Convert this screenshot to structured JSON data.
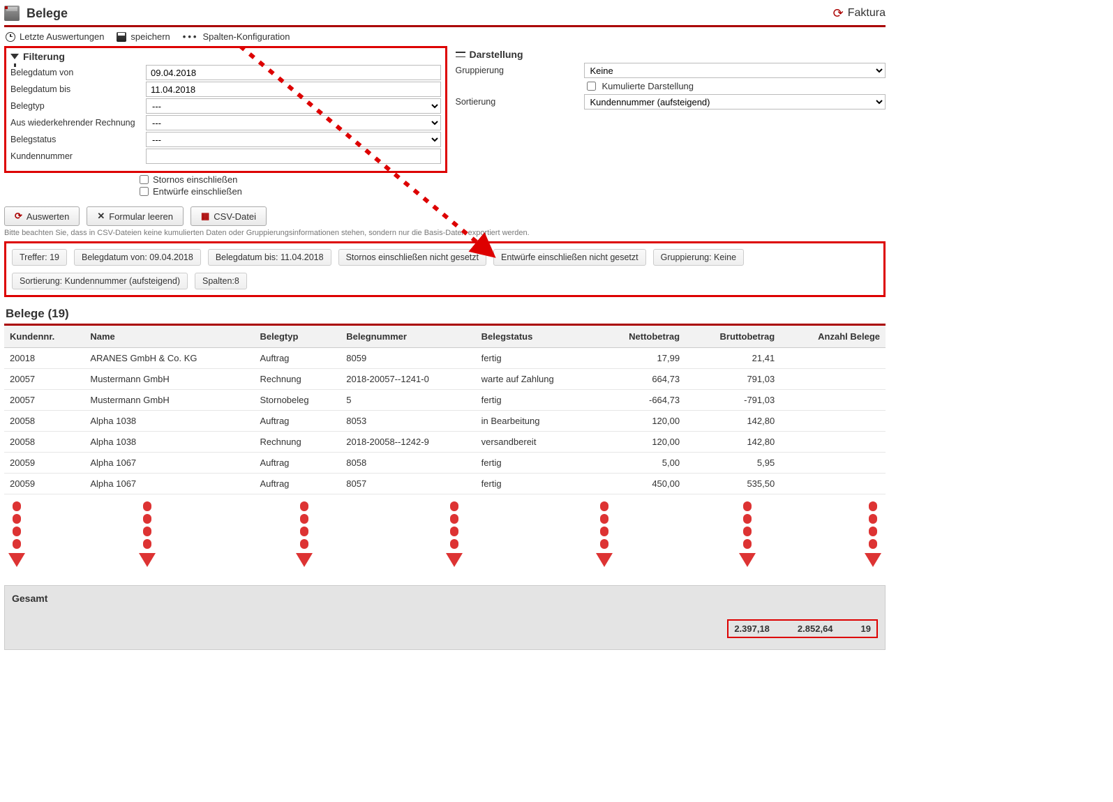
{
  "header": {
    "title": "Belege",
    "app_name": "Faktura"
  },
  "toolbar": {
    "recent": "Letzte Auswertungen",
    "save": "speichern",
    "columns": "Spalten-Konfiguration"
  },
  "filter": {
    "header": "Filterung",
    "labels": {
      "date_from": "Belegdatum von",
      "date_to": "Belegdatum bis",
      "beltype": "Belegtyp",
      "recurring": "Aus wiederkehrender Rechnung",
      "status": "Belegstatus",
      "custno": "Kundennummer"
    },
    "values": {
      "date_from": "09.04.2018",
      "date_to": "11.04.2018",
      "beltype": "---",
      "recurring": "---",
      "status": "---",
      "custno": ""
    },
    "checks": {
      "stornos": "Stornos einschließen",
      "drafts": "Entwürfe einschließen"
    }
  },
  "display": {
    "header": "Darstellung",
    "labels": {
      "grouping": "Gruppierung",
      "cumulated": "Kumulierte Darstellung",
      "sorting": "Sortierung"
    },
    "values": {
      "grouping": "Keine",
      "sorting": "Kundennummer (aufsteigend)"
    }
  },
  "buttons": {
    "eval": "Auswerten",
    "clear": "Formular leeren",
    "csv": "CSV-Datei"
  },
  "note": "Bitte beachten Sie, dass in CSV-Dateien keine kumulierten Daten oder Gruppierungsinformationen stehen, sondern nur die Basis-Daten exportiert werden.",
  "chips": [
    "Treffer: 19",
    "Belegdatum von: 09.04.2018",
    "Belegdatum bis: 11.04.2018",
    "Stornos einschließen nicht gesetzt",
    "Entwürfe einschließen nicht gesetzt",
    "Gruppierung: Keine",
    "Sortierung: Kundennummer (aufsteigend)",
    "Spalten:8"
  ],
  "table": {
    "title": "Belege (19)",
    "columns": [
      "Kundennr.",
      "Name",
      "Belegtyp",
      "Belegnummer",
      "Belegstatus",
      "Nettobetrag",
      "Bruttobetrag",
      "Anzahl Belege"
    ],
    "rows": [
      [
        "20018",
        "ARANES GmbH & Co. KG",
        "Auftrag",
        "8059",
        "fertig",
        "17,99",
        "21,41",
        ""
      ],
      [
        "20057",
        "Mustermann GmbH",
        "Rechnung",
        "2018-20057--1241-0",
        "warte auf Zahlung",
        "664,73",
        "791,03",
        ""
      ],
      [
        "20057",
        "Mustermann GmbH",
        "Stornobeleg",
        "5",
        "fertig",
        "-664,73",
        "-791,03",
        ""
      ],
      [
        "20058",
        "Alpha 1038",
        "Auftrag",
        "8053",
        "in Bearbeitung",
        "120,00",
        "142,80",
        ""
      ],
      [
        "20058",
        "Alpha 1038",
        "Rechnung",
        "2018-20058--1242-9",
        "versandbereit",
        "120,00",
        "142,80",
        ""
      ],
      [
        "20059",
        "Alpha 1067",
        "Auftrag",
        "8058",
        "fertig",
        "5,00",
        "5,95",
        ""
      ],
      [
        "20059",
        "Alpha 1067",
        "Auftrag",
        "8057",
        "fertig",
        "450,00",
        "535,50",
        ""
      ]
    ]
  },
  "totals": {
    "label": "Gesamt",
    "net": "2.397,18",
    "gross": "2.852,64",
    "count": "19"
  },
  "arrows": {
    "positions": [
      18,
      205,
      430,
      645,
      860,
      1065,
      1245
    ]
  }
}
